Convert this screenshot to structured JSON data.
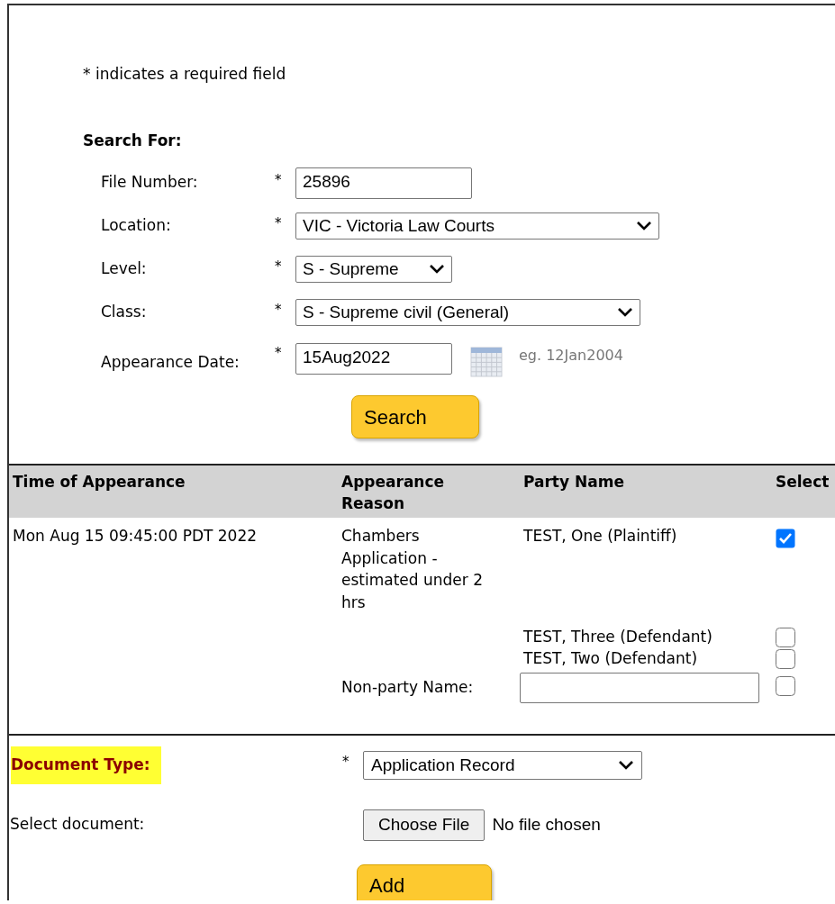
{
  "required_note": "* indicates a required field",
  "search": {
    "heading": "Search For:",
    "fields": [
      {
        "kind": "text",
        "label": "File Number:",
        "required_mark": "*",
        "value": "25896"
      },
      {
        "kind": "select",
        "label": "Location:",
        "required_mark": "*",
        "value": "VIC - Victoria Law Courts"
      },
      {
        "kind": "select",
        "label": "Level:",
        "required_mark": "*",
        "value": "S - Supreme"
      },
      {
        "kind": "select",
        "label": "Class:",
        "required_mark": "*",
        "value": "S - Supreme civil (General)"
      },
      {
        "kind": "date",
        "label": "Appearance Date:",
        "required_mark": "*",
        "value": "15Aug2022",
        "hint": "eg. 12Jan2004"
      }
    ],
    "button": "Search"
  },
  "table": {
    "columns": [
      "Time of Appearance",
      "Appearance Reason",
      "Party Name",
      "Select"
    ],
    "rows": [
      {
        "time": "Mon Aug 15 09:45:00 PDT 2022",
        "reason": "Chambers Application - estimated under 2 hrs",
        "parties": [
          {
            "kind": "party",
            "name": "TEST, One (Plaintiff)",
            "checked": true
          },
          {
            "kind": "party",
            "name": "TEST, Three (Defendant)",
            "checked": false
          },
          {
            "kind": "party",
            "name": "TEST, Two (Defendant)",
            "checked": false
          },
          {
            "kind": "input",
            "label": "Non-party Name:",
            "checked": false
          }
        ]
      }
    ]
  },
  "document": {
    "label": "Document Type:",
    "highlighted": true,
    "required_mark": "*",
    "value": "Application Record",
    "file_label": "Select document:",
    "file_button": "Choose File",
    "file_status": "No file chosen",
    "add_button": "Add"
  }
}
